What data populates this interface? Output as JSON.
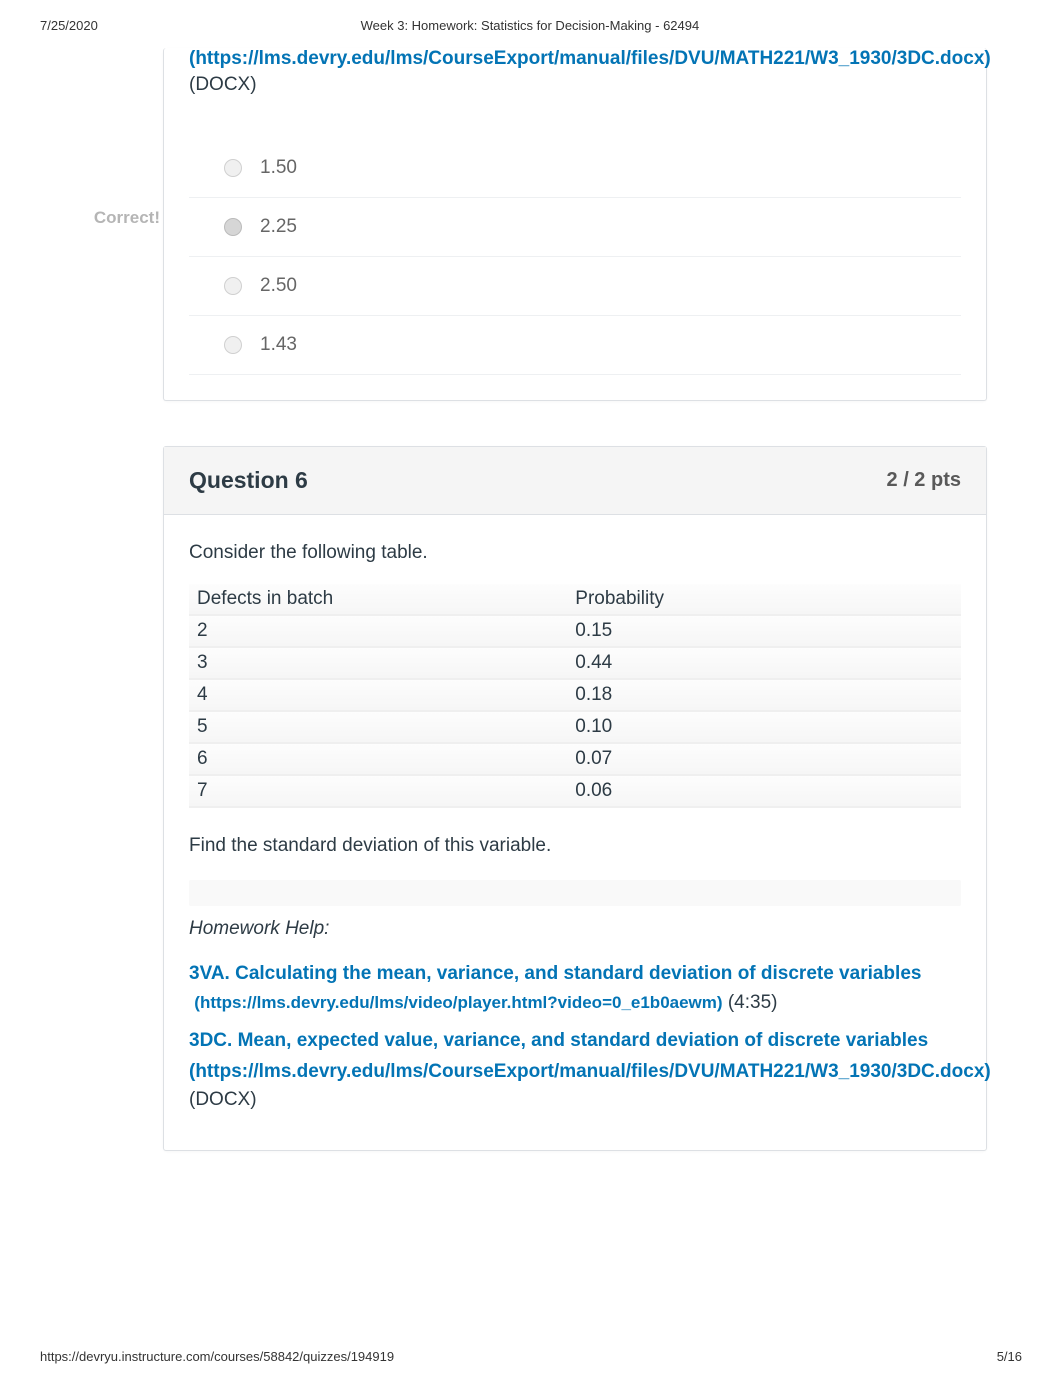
{
  "header": {
    "date": "7/25/2020",
    "title": "Week 3: Homework: Statistics for Decision-Making - 62494"
  },
  "q5": {
    "correct_label": "Correct!",
    "url_line": "(https://lms.devry.edu/lms/CourseExport/manual/files/DVU/MATH221/W3_1930/3DC.docx)",
    "docx": "(DOCX)",
    "answers": [
      {
        "text": "1.50",
        "selected": false
      },
      {
        "text": "2.25",
        "selected": true
      },
      {
        "text": "2.50",
        "selected": false
      },
      {
        "text": "1.43",
        "selected": false
      }
    ]
  },
  "q6": {
    "title": "Question 6",
    "points": "2 / 2 pts",
    "intro": "Consider the following table.",
    "table": {
      "head": [
        "Defects in batch",
        "Probability"
      ],
      "rows": [
        [
          "2",
          "0.15"
        ],
        [
          "3",
          "0.44"
        ],
        [
          "4",
          "0.18"
        ],
        [
          "5",
          "0.10"
        ],
        [
          "6",
          "0.07"
        ],
        [
          "7",
          "0.06"
        ]
      ]
    },
    "prompt": "Find the standard deviation of this variable.",
    "help_label": "Homework Help:",
    "help1": {
      "text": "3VA. Calculating the mean, variance, and standard deviation of discrete variables",
      "url": "(https://lms.devry.edu/lms/video/player.html?video=0_e1b0aewm)",
      "suffix": " (4:35)"
    },
    "help2": {
      "text": "3DC. Mean, expected value, variance, and standard deviation of discrete variables",
      "url": "(https://lms.devry.edu/lms/CourseExport/manual/files/DVU/MATH221/W3_1930/3DC.docx)",
      "docx": "(DOCX)"
    }
  },
  "footer": {
    "url": "https://devryu.instructure.com/courses/58842/quizzes/194919",
    "page": "5/16"
  }
}
